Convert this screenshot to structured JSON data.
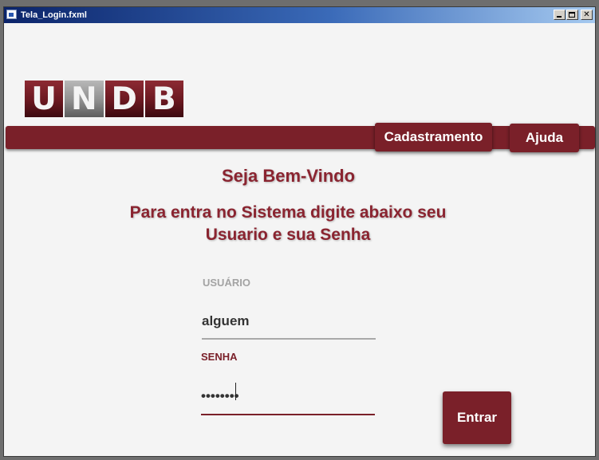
{
  "window": {
    "title": "Tela_Login.fxml",
    "controls": {
      "minimize": "_",
      "maximize": "□",
      "close": "✕"
    }
  },
  "logo": {
    "letters": [
      "U",
      "N",
      "D",
      "B"
    ]
  },
  "nav": {
    "cadastramento": "Cadastramento",
    "ajuda": "Ajuda"
  },
  "welcome": "Seja Bem-Vindo",
  "instruction": "Para entra no Sistema digite abaixo seu Usuario e sua Senha",
  "form": {
    "user_label": "USUÁRIO",
    "user_value": "alguem",
    "pass_label": "SENHA",
    "pass_value": "••••••••"
  },
  "submit": "Entrar",
  "colors": {
    "brand": "#7a2029",
    "text_brand": "#8a2430",
    "muted": "#a3a3a3"
  },
  "icons": [
    "app-icon",
    "minimize-icon",
    "maximize-icon",
    "close-icon"
  ]
}
